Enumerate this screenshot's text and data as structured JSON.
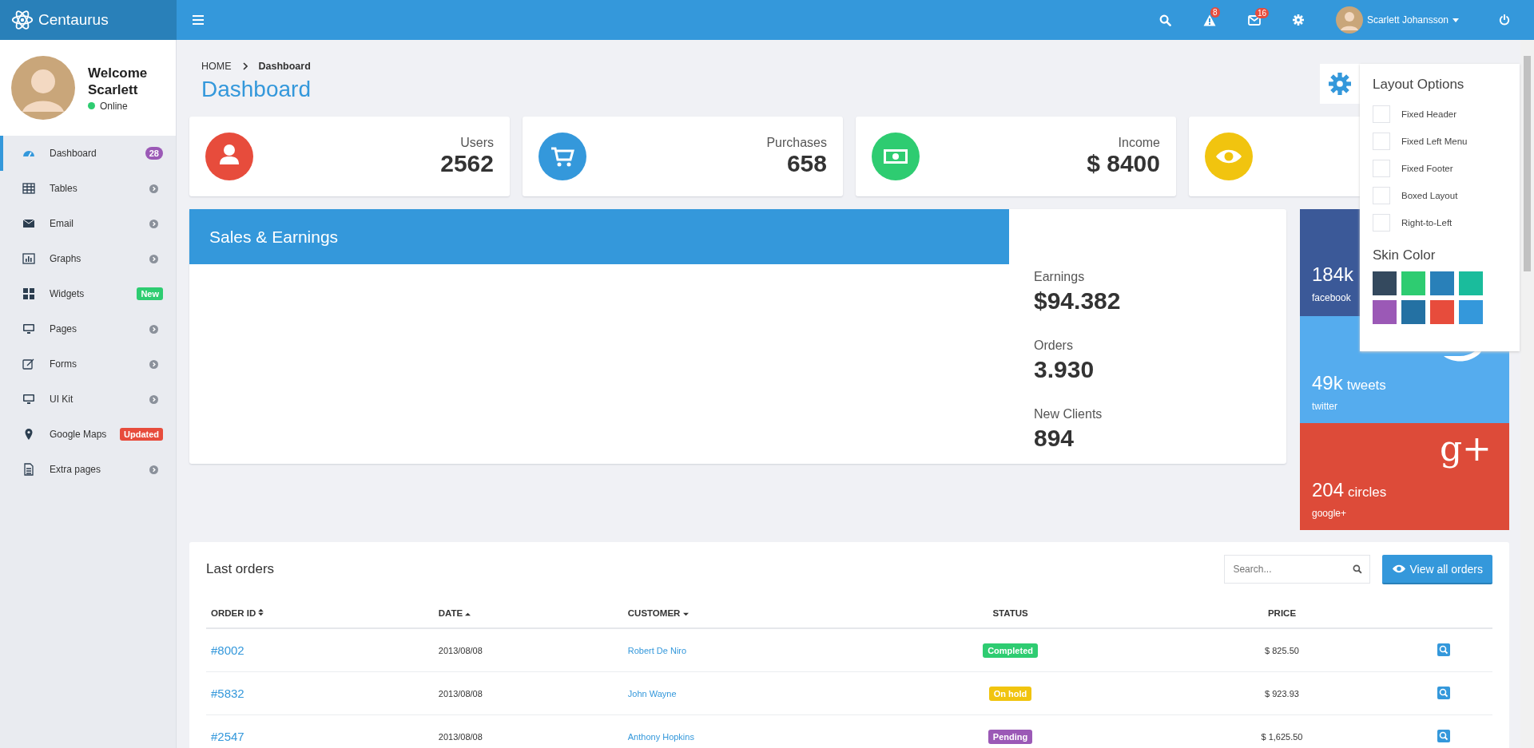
{
  "brand": {
    "name": "Centaurus"
  },
  "topbar": {
    "notifications": [
      {
        "kind": "alert",
        "count": "8"
      },
      {
        "kind": "mail",
        "count": "16"
      }
    ],
    "user_name": "Scarlett Johansson"
  },
  "profile": {
    "welcome": "Welcome",
    "name": "Scarlett",
    "status": "Online"
  },
  "sidebar": {
    "items": [
      {
        "kind": "dashboard",
        "label": "Dashboard",
        "selected": true,
        "badge": "28",
        "color": "#9b59b6"
      },
      {
        "kind": "tables",
        "label": "Tables",
        "selected": false
      },
      {
        "kind": "email",
        "label": "Email",
        "selected": false
      },
      {
        "kind": "graphs",
        "label": "Graphs",
        "selected": false
      },
      {
        "kind": "widgets",
        "label": "Widgets",
        "selected": false,
        "badge": "New",
        "color": "#2ecc71"
      },
      {
        "kind": "pages",
        "label": "Pages",
        "selected": false
      },
      {
        "kind": "forms",
        "label": "Forms",
        "selected": false
      },
      {
        "kind": "pages",
        "label": "UI Kit",
        "selected": false
      },
      {
        "kind": "maps",
        "label": "Google Maps",
        "selected": false,
        "badge": "Updated",
        "color": "#e74c3c"
      },
      {
        "kind": "file",
        "label": "Extra pages",
        "selected": false
      }
    ]
  },
  "breadcrumb": [
    "HOME",
    "Dashboard"
  ],
  "page_title": "Dashboard",
  "stats": [
    {
      "kind": "user",
      "label": "Users",
      "value": "2562",
      "color": "#e74c3c"
    },
    {
      "kind": "cart",
      "label": "Purchases",
      "value": "658",
      "color": "#3498db"
    },
    {
      "kind": "money",
      "label": "Income",
      "value": "$ 8400",
      "color": "#2ecc71"
    },
    {
      "kind": "eye",
      "color": "#f1c40f"
    }
  ],
  "sales": {
    "title": "Sales & Earnings",
    "figures": [
      {
        "label": "Earnings",
        "value": "$94.382"
      },
      {
        "label": "Orders",
        "value": "3.930"
      },
      {
        "label": "New Clients",
        "value": "894"
      }
    ]
  },
  "social": [
    {
      "kind": "facebook",
      "value": "184k",
      "label": "facebook"
    },
    {
      "kind": "twitter",
      "value": "49k",
      "unit": "tweets",
      "label": "twitter"
    },
    {
      "kind": "google",
      "mark": "g+",
      "value": "204",
      "unit": "circles",
      "label": "google+"
    }
  ],
  "layout_options": {
    "title": "Layout Options",
    "options": [
      {
        "label": "Fixed Header",
        "checked": false
      },
      {
        "label": "Fixed Left Menu",
        "checked": false
      },
      {
        "label": "Fixed Footer",
        "checked": false
      },
      {
        "label": "Boxed Layout",
        "checked": false
      },
      {
        "label": "Right-to-Left",
        "checked": false
      }
    ],
    "skin_title": "Skin Color",
    "skins": [
      {
        "color": "#34495e"
      },
      {
        "color": "#2ecc71"
      },
      {
        "color": "#2980b9"
      },
      {
        "color": "#1abc9c"
      },
      {
        "color": "#9b59b6"
      },
      {
        "color": "#2471a3"
      },
      {
        "color": "#e74c3c"
      },
      {
        "color": "#3498db"
      }
    ]
  },
  "orders": {
    "title": "Last orders",
    "search_placeholder": "Search...",
    "button": "View all orders",
    "columns": [
      {
        "kind": "sortable",
        "label": "ORDER ID"
      },
      {
        "kind": "ascending",
        "label": "DATE"
      },
      {
        "kind": "descending",
        "label": "CUSTOMER"
      },
      {
        "kind": "plain",
        "label": "STATUS"
      },
      {
        "kind": "plain",
        "label": "PRICE"
      }
    ],
    "rows": [
      {
        "id": "#8002",
        "date": "2013/08/08",
        "customer": "Robert De Niro",
        "status": "Completed",
        "color": "#2ecc71",
        "price": "$ 825.50"
      },
      {
        "id": "#5832",
        "date": "2013/08/08",
        "customer": "John Wayne",
        "status": "On hold",
        "color": "#f1c40f",
        "price": "$ 923.93"
      },
      {
        "id": "#2547",
        "date": "2013/08/08",
        "customer": "Anthony Hopkins",
        "status": "Pending",
        "color": "#9b59b6",
        "price": "$ 1,625.50"
      }
    ]
  }
}
